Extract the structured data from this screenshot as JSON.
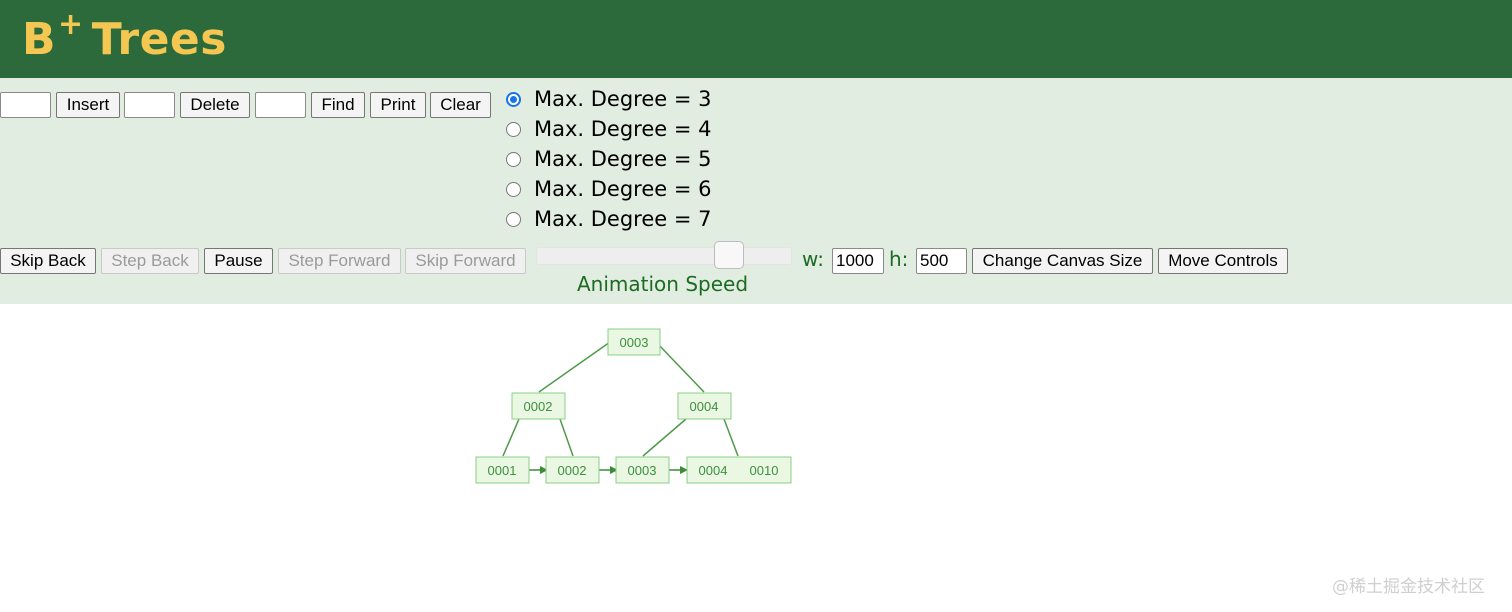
{
  "header": {
    "title_main": "B",
    "title_sup": "+",
    "title_rest": "Trees"
  },
  "colors": {
    "header_bg": "#2d6a3b",
    "title_color": "#f3c751",
    "controls_bg": "#e2ede1",
    "accent_green": "#1c6b22",
    "node_fill": "#e9f7e3",
    "node_border": "#8bcf83",
    "edge_color": "#4e9a4b"
  },
  "toolbar": {
    "insert_value": "",
    "insert_label": "Insert",
    "delete_value": "",
    "delete_label": "Delete",
    "find_value": "",
    "find_label": "Find",
    "print_label": "Print",
    "clear_label": "Clear"
  },
  "degree_options": [
    {
      "label": "Max. Degree = 3",
      "selected": true
    },
    {
      "label": "Max. Degree = 4",
      "selected": false
    },
    {
      "label": "Max. Degree = 5",
      "selected": false
    },
    {
      "label": "Max. Degree = 6",
      "selected": false
    },
    {
      "label": "Max. Degree = 7",
      "selected": false
    }
  ],
  "animation": {
    "skip_back": "Skip Back",
    "step_back": "Step Back",
    "pause": "Pause",
    "step_forward": "Step Forward",
    "skip_forward": "Skip Forward",
    "speed_label": "Animation Speed",
    "speed_fraction": 0.75
  },
  "canvas_size": {
    "w_label": "w:",
    "w_value": "1000",
    "h_label": "h:",
    "h_value": "500",
    "change_label": "Change Canvas Size",
    "move_label": "Move Controls"
  },
  "tree": {
    "root": "0003",
    "level1": [
      "0002",
      "0004"
    ],
    "leaves": [
      "0001",
      "0002",
      "0003",
      "0004",
      "0010"
    ]
  },
  "watermark": "@稀土掘金技术社区"
}
